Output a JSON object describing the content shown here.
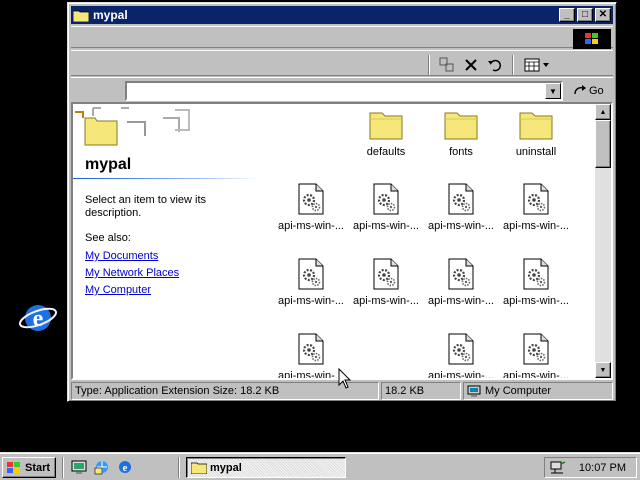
{
  "window": {
    "title": "mypal",
    "minimize": "_",
    "maximize": "□",
    "close": "✕"
  },
  "addressbar": {
    "value": "",
    "go_label": "Go"
  },
  "leftpane": {
    "title": "mypal",
    "description": "Select an item to view its description.",
    "see_also": "See also:",
    "links": [
      "My Documents",
      "My Network Places",
      "My Computer"
    ]
  },
  "files": [
    {
      "label": "defaults",
      "type": "folder"
    },
    {
      "label": "fonts",
      "type": "folder"
    },
    {
      "label": "uninstall",
      "type": "folder"
    },
    {
      "label": "api-ms-win-...",
      "type": "dll"
    },
    {
      "label": "api-ms-win-...",
      "type": "dll"
    },
    {
      "label": "api-ms-win-...",
      "type": "dll"
    },
    {
      "label": "api-ms-win-...",
      "type": "dll"
    },
    {
      "label": "api-ms-win-...",
      "type": "dll"
    },
    {
      "label": "api-ms-win-...",
      "type": "dll"
    },
    {
      "label": "api-ms-win-...",
      "type": "dll"
    },
    {
      "label": "api-ms-win-...",
      "type": "dll"
    },
    {
      "label": "api-ms-win-...",
      "type": "dll"
    },
    {
      "label": "api-ms-win-...",
      "type": "dll"
    },
    {
      "label": "api-ms-win-...",
      "type": "dll"
    }
  ],
  "statusbar": {
    "info": "Type: Application Extension Size: 18.2 KB",
    "size": "18.2 KB",
    "zone": "My Computer"
  },
  "taskbar": {
    "start": "Start",
    "task": "mypal",
    "clock": "10:07 PM"
  },
  "colors": {
    "titlebar": "#0a246a",
    "face": "#c0c0c0",
    "link": "#0000cc",
    "folder": "#f5e77a"
  }
}
